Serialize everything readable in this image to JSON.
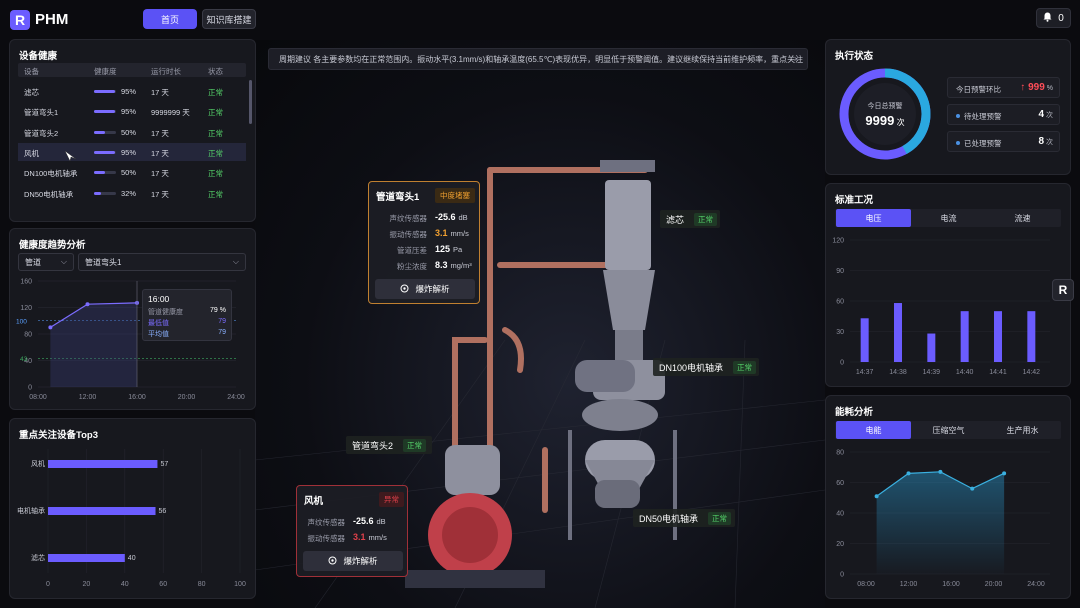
{
  "app": {
    "title": "PHM",
    "logo_letter": "R"
  },
  "nav": {
    "home": "首页",
    "knowledge": "知识库搭建"
  },
  "notifications": {
    "count": "0"
  },
  "device_health": {
    "title": "设备健康",
    "headers": [
      "设备",
      "健康度",
      "运行时长",
      "状态"
    ],
    "rows": [
      {
        "name": "滤芯",
        "health": 95,
        "health_text": "95%",
        "runtime": "17 天",
        "status": "正常"
      },
      {
        "name": "管道弯头1",
        "health": 95,
        "health_text": "95%",
        "runtime": "9999999 天",
        "status": "正常"
      },
      {
        "name": "管道弯头2",
        "health": 50,
        "health_text": "50%",
        "runtime": "17 天",
        "status": "正常"
      },
      {
        "name": "风机",
        "health": 95,
        "health_text": "95%",
        "runtime": "17 天",
        "status": "正常"
      },
      {
        "name": "DN100电机轴承",
        "health": 50,
        "health_text": "50%",
        "runtime": "17 天",
        "status": "正常"
      },
      {
        "name": "DN50电机轴承",
        "health": 32,
        "health_text": "32%",
        "runtime": "17 天",
        "status": "正常"
      }
    ]
  },
  "trend": {
    "title": "健康度趋势分析",
    "select1": "管道",
    "select2": "管道弯头1",
    "tooltip": {
      "time": "16:00",
      "l1": "管道健康度",
      "v1": "79 %",
      "l2": "最低值",
      "v2": "79",
      "l3": "平均值",
      "v3": "79"
    },
    "ref_labels": [
      "100",
      "43"
    ]
  },
  "top3": {
    "title": "重点关注设备Top3"
  },
  "alert": {
    "text": "周期建议  各主要参数均在正常范围内。振动水平(3.1mm/s)和轴承温度(65.5℃)表现优异，明显低于预警阈值。建议继续保持当前维护频率，重点关注",
    "close": "×"
  },
  "popup1": {
    "title": "管道弯头1",
    "tag": "中度堵塞",
    "metrics": [
      {
        "label": "声纹传感器",
        "value": "-25.6",
        "unit": "dB"
      },
      {
        "label": "振动传感器",
        "value": "3.1",
        "unit": "mm/s"
      },
      {
        "label": "管道压差",
        "value": "125",
        "unit": "Pa"
      },
      {
        "label": "粉尘浓度",
        "value": "8.3",
        "unit": "mg/m³"
      }
    ],
    "button": "爆炸解析"
  },
  "popup2": {
    "title": "风机",
    "tag": "异常",
    "metrics": [
      {
        "label": "声纹传感器",
        "value": "-25.6",
        "unit": "dB"
      },
      {
        "label": "振动传感器",
        "value": "3.1",
        "unit": "mm/s"
      }
    ],
    "button": "爆炸解析"
  },
  "chips": {
    "filter": {
      "name": "滤芯",
      "status": "正常"
    },
    "dn100": {
      "name": "DN100电机轴承",
      "status": "正常"
    },
    "elbow2": {
      "name": "管道弯头2",
      "status": "正常"
    },
    "dn50": {
      "name": "DN50电机轴承",
      "status": "正常"
    }
  },
  "exec": {
    "title": "执行状态",
    "center_label": "今日总预警",
    "center_value": "9999",
    "center_unit": "次",
    "donut_fraction": 0.42,
    "cards": [
      {
        "label": "今日预警环比",
        "value": "↑ 999",
        "unit": "%"
      },
      {
        "label": "待处理预警",
        "value": "4",
        "unit": "次"
      },
      {
        "label": "已处理预警",
        "value": "8",
        "unit": "次"
      }
    ]
  },
  "standard": {
    "title": "标准工况",
    "tabs": [
      "电压",
      "电流",
      "流速"
    ]
  },
  "energy": {
    "title": "能耗分析",
    "tabs": [
      "电能",
      "压缩空气",
      "生产用水"
    ]
  },
  "colors": {
    "accent": "#5b52f5",
    "ok": "#55d36a",
    "warn": "#f0a030",
    "danger": "#e0404a",
    "donut_blue": "#2aa8e0"
  },
  "chart_data": [
    {
      "type": "line",
      "title": "健康度趋势分析",
      "x": [
        "08:00",
        "12:00",
        "16:00",
        "20:00",
        "24:00"
      ],
      "series": [
        {
          "x": [
            "09:00",
            "12:00",
            "16:00"
          ],
          "values": [
            90,
            125,
            127
          ]
        }
      ],
      "ylim": [
        0,
        160
      ],
      "yticks": [
        "0",
        "40",
        "80",
        "120",
        "160"
      ]
    },
    {
      "type": "bar",
      "title": "重点关注设备Top3",
      "orientation": "horizontal",
      "categories": [
        "风机",
        "电机轴承",
        "滤芯"
      ],
      "values": [
        57,
        56,
        40
      ],
      "xlim": [
        0,
        100
      ],
      "xticks": [
        "0",
        "20",
        "40",
        "60",
        "80",
        "100"
      ]
    },
    {
      "type": "bar",
      "title": "标准工况",
      "categories": [
        "14:37",
        "14:38",
        "14:39",
        "14:40",
        "14:41",
        "14:42"
      ],
      "values": [
        43,
        58,
        28,
        50,
        50,
        50
      ],
      "ylim": [
        0,
        120
      ],
      "yticks": [
        "0",
        "30",
        "60",
        "90",
        "120"
      ]
    },
    {
      "type": "area",
      "title": "能耗分析",
      "x": [
        "08:00",
        "12:00",
        "16:00",
        "20:00",
        "24:00"
      ],
      "series": [
        {
          "x": [
            "09:00",
            "12:00",
            "15:00",
            "18:00",
            "21:00"
          ],
          "values": [
            51,
            66,
            67,
            56,
            66
          ]
        }
      ],
      "ylim": [
        0,
        80
      ],
      "yticks": [
        "0",
        "20",
        "40",
        "60",
        "80"
      ]
    }
  ]
}
